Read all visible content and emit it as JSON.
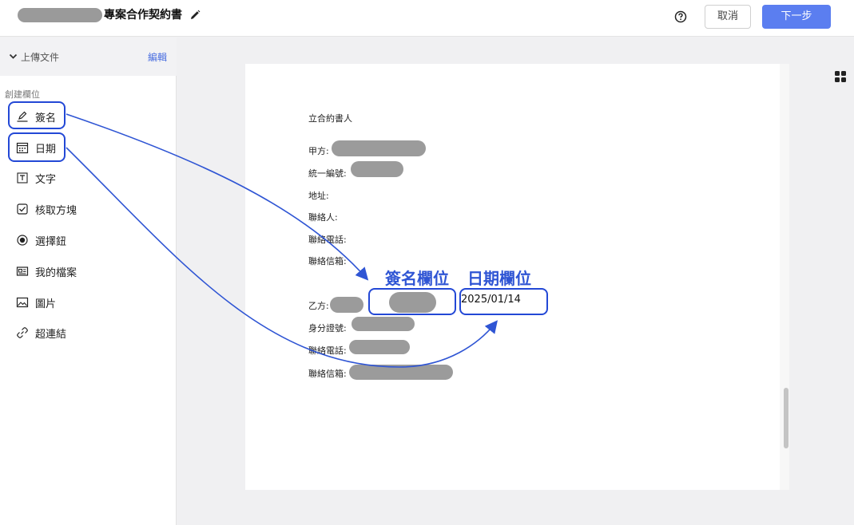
{
  "header": {
    "title": "專案合作契約書",
    "cancel_label": "取消",
    "next_label": "下一步",
    "accent": "#5b7ef0"
  },
  "sidebar": {
    "upload_label": "上傳文件",
    "edit_label": "編輯",
    "section_label": "創建欄位",
    "items": [
      {
        "label": "簽名",
        "icon": "signature-icon"
      },
      {
        "label": "日期",
        "icon": "calendar-icon"
      },
      {
        "label": "文字",
        "icon": "text-field-icon"
      },
      {
        "label": "核取方塊",
        "icon": "checkbox-icon"
      },
      {
        "label": "選擇鈕",
        "icon": "radio-icon"
      },
      {
        "label": "我的檔案",
        "icon": "profile-card-icon"
      },
      {
        "label": "圖片",
        "icon": "image-icon"
      },
      {
        "label": "超連結",
        "icon": "link-icon"
      }
    ]
  },
  "document": {
    "heading": "立合約書人",
    "party_a": {
      "name_label": "甲方:",
      "tax_id_label": "統一編號:",
      "address_label": "地址:",
      "contact_label": "聯絡人:",
      "phone_label": "聯絡電話:",
      "email_label": "聯絡信箱:"
    },
    "party_b": {
      "name_label": "乙方:",
      "id_label": "身分證號:",
      "phone_label": "聯絡電話:",
      "email_label": "聯絡信箱:"
    },
    "date_value": "2025/01/14"
  },
  "annotations": {
    "signature_field_label": "簽名欄位",
    "date_field_label": "日期欄位",
    "highlight_color": "#2348d6"
  }
}
